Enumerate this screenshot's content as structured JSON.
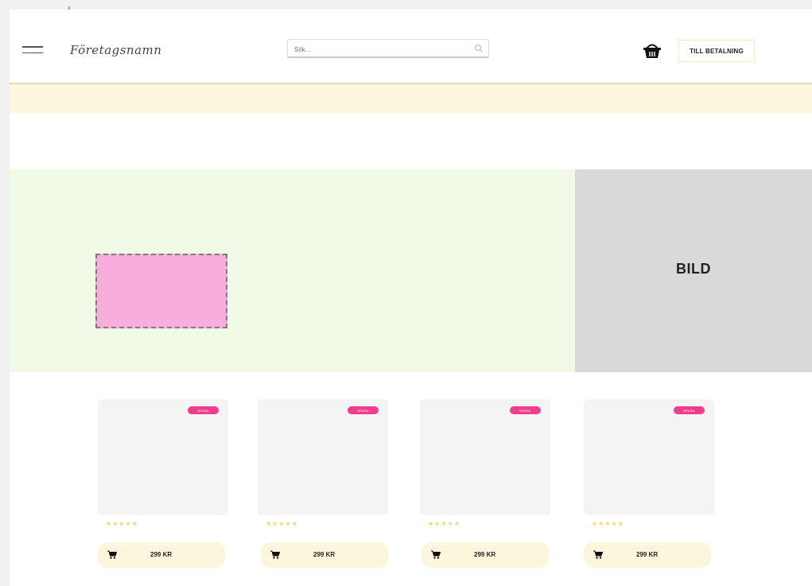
{
  "header": {
    "logo": "Företagsnamn",
    "search_placeholder": "Sök...",
    "checkout_label": "TILL BETALNING"
  },
  "hero": {
    "image_label": "BILD"
  },
  "products": [
    {
      "badge": "SPARA",
      "rating": "★★★★★",
      "price": "299 KR"
    },
    {
      "badge": "SPARA",
      "rating": "★★★★★",
      "price": "299 KR"
    },
    {
      "badge": "SPARA",
      "rating": "★★★★★",
      "price": "299 KR"
    },
    {
      "badge": "SPARA",
      "rating": "★★★★★",
      "price": "299 KR"
    }
  ],
  "colors": {
    "promo_bar": "#fcf6dc",
    "hero_bg": "#f1fae7",
    "placeholder": "#f7aedd",
    "image_bg": "#d9d9d9",
    "sale_badge": "#ee3d8e",
    "stars": "#f2d56b"
  }
}
